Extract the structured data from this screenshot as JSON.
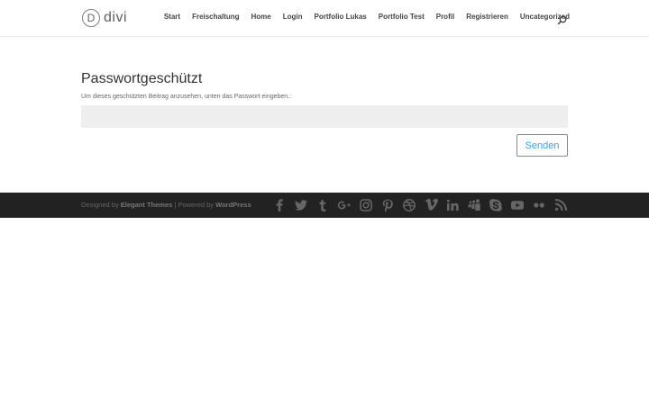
{
  "header": {
    "logo_letter": "D",
    "logo_text": "divi",
    "nav": [
      "Start",
      "Freischaltung",
      "Home",
      "Login",
      "Portfolio Lukas",
      "Portfolio Test",
      "Profil",
      "Registrieren",
      "Uncategorized"
    ],
    "search_icon": "search-icon"
  },
  "main": {
    "title": "Passwortgeschützt",
    "hint": "Um dieses geschützten Beitrag anzusehen, unten das Passwort eingeben.:",
    "password_value": "",
    "submit_label": "Senden"
  },
  "footer": {
    "designed_by": "Designed by",
    "theme_name": "Elegant Themes",
    "separator": "| Powered by",
    "platform": "WordPress",
    "social_icons": [
      "facebook-icon",
      "twitter-icon",
      "tumblr-icon",
      "google-plus-icon",
      "instagram-icon",
      "pinterest-icon",
      "dribbble-icon",
      "vimeo-icon",
      "linkedin-icon",
      "myspace-icon",
      "skype-icon",
      "youtube-icon",
      "flickr-icon",
      "rss-icon"
    ]
  },
  "colors": {
    "accent": "#2ea3f2",
    "footer_bg": "#222222",
    "field_bg": "#eeeeee"
  }
}
